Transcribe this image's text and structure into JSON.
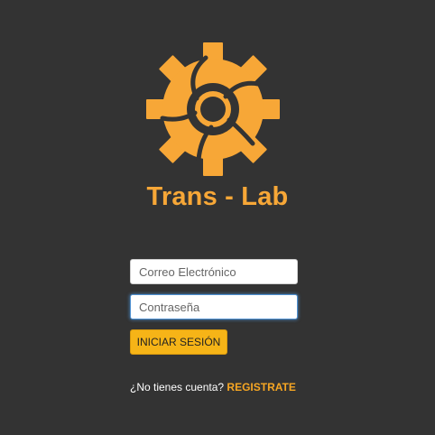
{
  "brand": {
    "name": "Trans - Lab",
    "logo_icon": "gear-logo-icon",
    "accent_color": "#f7a737"
  },
  "login_form": {
    "email_placeholder": "Correo Electrónico",
    "password_placeholder": "Contraseña",
    "submit_label": "INICIAR SESIÓN",
    "submit_color": "#f6b417"
  },
  "signup": {
    "prompt": "¿No tienes cuenta?",
    "link_label": "REGISTRATE"
  }
}
